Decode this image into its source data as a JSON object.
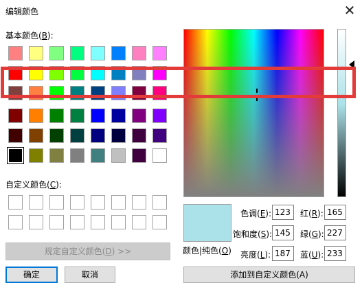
{
  "window": {
    "title": "编辑颜色",
    "close_icon": "close-icon"
  },
  "basic_colors": {
    "label": "基本颜色(",
    "hotkey": "B",
    "label_end": "):",
    "rows": [
      [
        "#ff8080",
        "#ffff80",
        "#80ff80",
        "#00ff80",
        "#80ffff",
        "#0080ff",
        "#ff80c0",
        "#ff80ff"
      ],
      [
        "#ff0000",
        "#ffff00",
        "#80ff00",
        "#00ff40",
        "#00ffff",
        "#0080c0",
        "#8080c0",
        "#ff00ff"
      ],
      [
        "#804040",
        "#ff8040",
        "#00ff00",
        "#008080",
        "#004080",
        "#8080ff",
        "#800040",
        "#ff0080"
      ],
      [
        "#800000",
        "#ff8000",
        "#008000",
        "#008040",
        "#0000ff",
        "#0000a0",
        "#800080",
        "#8000ff"
      ],
      [
        "#400000",
        "#804000",
        "#004000",
        "#004040",
        "#000080",
        "#000040",
        "#400040",
        "#400080"
      ],
      [
        "#000000",
        "#808000",
        "#808040",
        "#808080",
        "#408080",
        "#c0c0c0",
        "#400040",
        "#ffffff"
      ]
    ],
    "selected_index": [
      5,
      0
    ]
  },
  "custom_colors": {
    "label": "自定义颜色(",
    "hotkey": "C",
    "label_end": "):"
  },
  "define_custom_button": {
    "label": "规定自定义颜色(",
    "hotkey": "D",
    "label_end": ") >>"
  },
  "ok_button": {
    "label": "确定"
  },
  "cancel_button": {
    "label": "取消"
  },
  "add_custom_button": {
    "label": "添加到自定义颜色(A)"
  },
  "preview": {
    "label": "颜色|纯色(",
    "hotkey": "O",
    "label_end": ")",
    "color": "#abe2e9"
  },
  "hsl": {
    "hue": {
      "label": "色调(",
      "hotkey": "E",
      "label_end": "):",
      "value": "123"
    },
    "sat": {
      "label": "饱和度(",
      "hotkey": "S",
      "label_end": "):",
      "value": "145"
    },
    "lum": {
      "label": "亮度(",
      "hotkey": "L",
      "label_end": "):",
      "value": "187"
    }
  },
  "rgb": {
    "red": {
      "label": "红(",
      "hotkey": "R",
      "label_end": "):",
      "value": "165"
    },
    "green": {
      "label": "绿(",
      "hotkey": "G",
      "label_end": "):",
      "value": "227"
    },
    "blue": {
      "label": "蓝(",
      "hotkey": "U",
      "label_end": "):",
      "value": "233"
    }
  },
  "annotation": {
    "color": "#e33a3a"
  }
}
